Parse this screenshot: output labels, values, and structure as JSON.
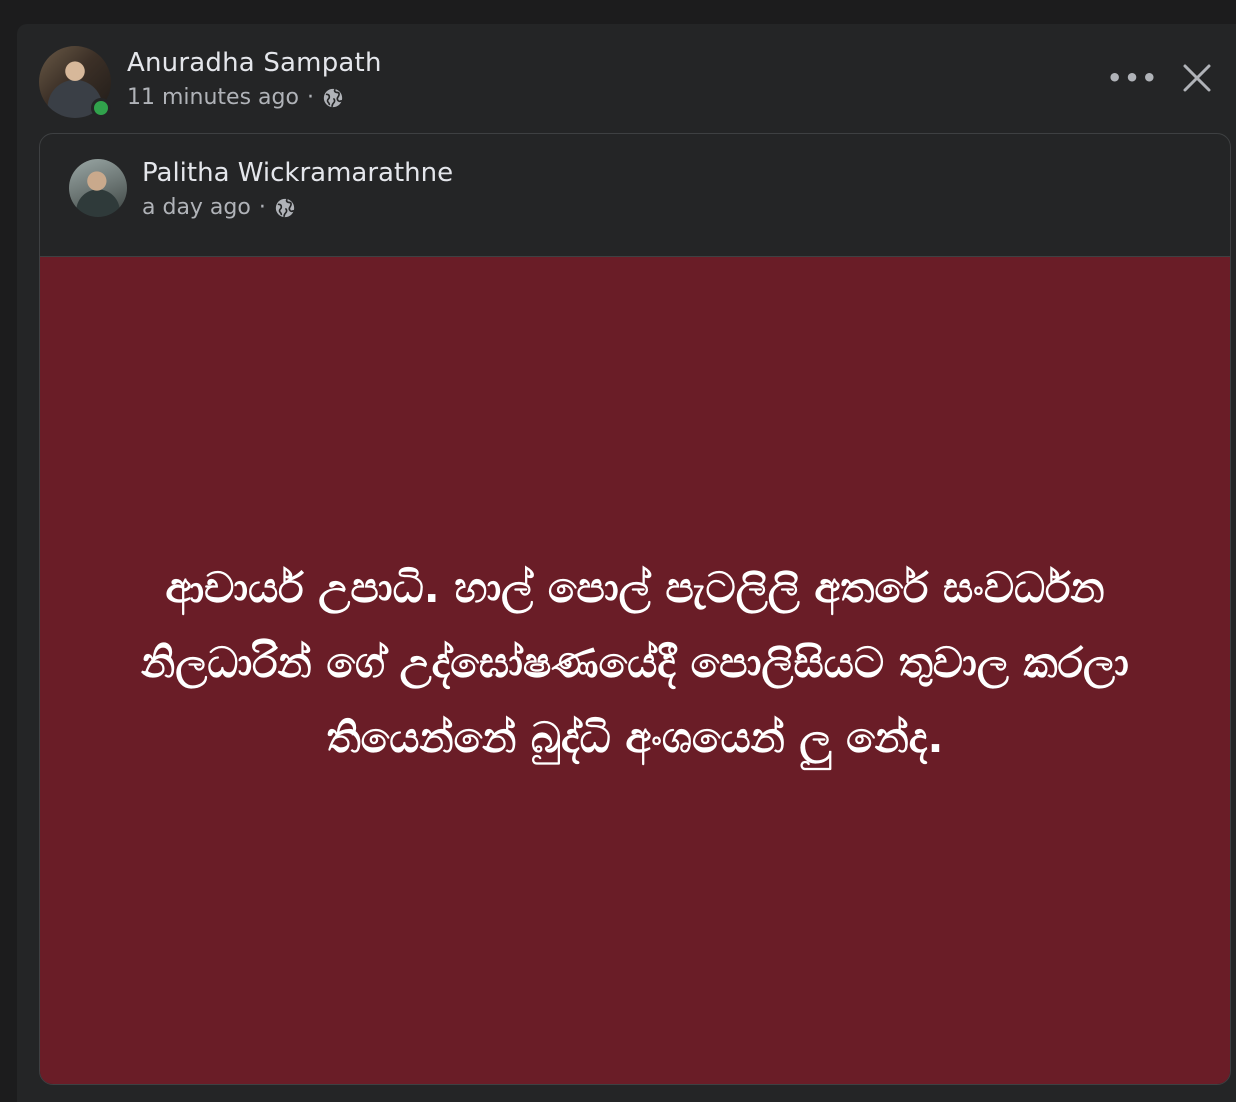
{
  "post": {
    "author": "Anuradha Sampath",
    "time": "11 minutes ago",
    "separator": "·",
    "privacy_icon": "globe-icon",
    "online": true,
    "more_icon": "more-horizontal-icon",
    "more_label": "•••",
    "close_icon": "close-icon"
  },
  "shared_post": {
    "author": "Palitha Wickramarathne",
    "time": "a day ago",
    "separator": "·",
    "privacy_icon": "globe-icon",
    "background_color": "#6a1d27",
    "text": "ආචාර්ය උපාධි. හාල් පොල් පැටලිලි අතරේ සංවර්ධන නිලධාරින් ගේ උද්ඝෝෂණයේදී පොලිසියට තුවාල කරලා තියෙන්නේ බුද්ධි අංශයෙන් ලු නේද."
  },
  "colors": {
    "card_bg": "#242526",
    "online_green": "#31a24c",
    "text_primary": "#e4e6eb",
    "text_secondary": "#b0b3b8"
  }
}
